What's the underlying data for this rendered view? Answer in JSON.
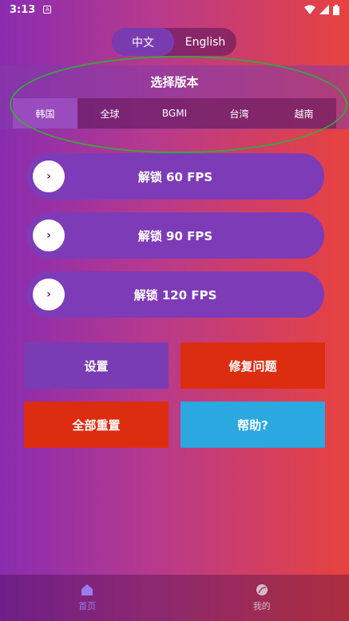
{
  "status_bar": {
    "time": "3:13",
    "notif_icon": "A"
  },
  "lang_toggle": {
    "chinese": "中文",
    "english": "English"
  },
  "version": {
    "title": "选择版本",
    "tabs": [
      "韩国",
      "全球",
      "BGMI",
      "台湾",
      "越南"
    ],
    "selected": "韩国"
  },
  "fps_buttons": [
    {
      "label": "解锁 60 FPS"
    },
    {
      "label": "解锁 90 FPS"
    },
    {
      "label": "解锁 120 FPS"
    }
  ],
  "arrow_glyph": "›",
  "actions": {
    "settings": "设置",
    "repair": "修复问题",
    "reset": "全部重置",
    "help": "帮助?"
  },
  "colors": {
    "settings": "#7a3cb4",
    "repair": "#dc2d10",
    "reset": "#dc2d10",
    "help": "#2aa8df"
  },
  "bottom_nav": {
    "home": "首页",
    "mine": "我的"
  }
}
